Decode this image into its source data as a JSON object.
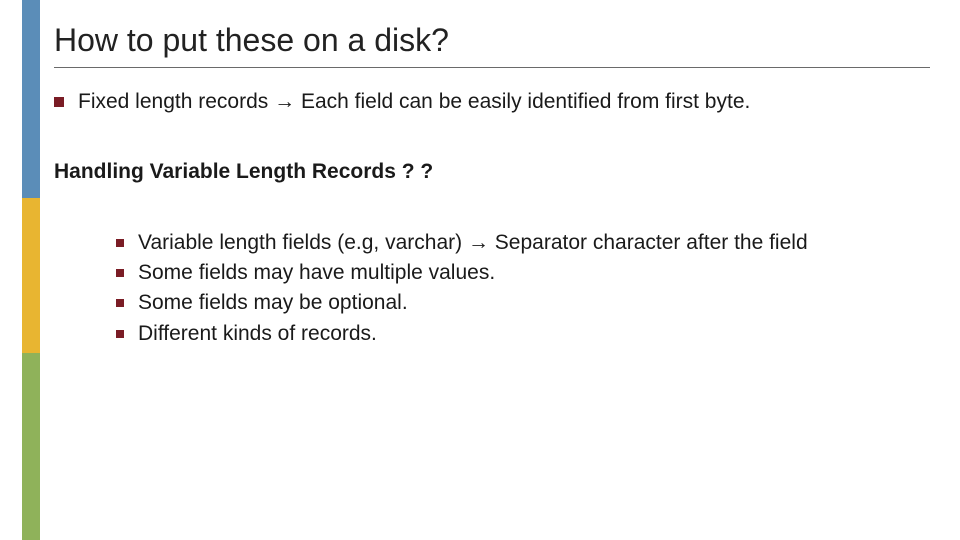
{
  "title": "How to put these on a disk?",
  "line1_a": "Fixed length records ",
  "arrow": "→",
  "line1_b": " Each field can be easily identified from first byte.",
  "subhead": "Handling Variable Length Records ? ?",
  "sub": {
    "a1": "Variable length fields (e.g, varchar)  ",
    "a2": " Separator character after the field",
    "b": "Some fields may have multiple values.",
    "c": "Some fields may be optional.",
    "d": "Different kinds of records."
  }
}
